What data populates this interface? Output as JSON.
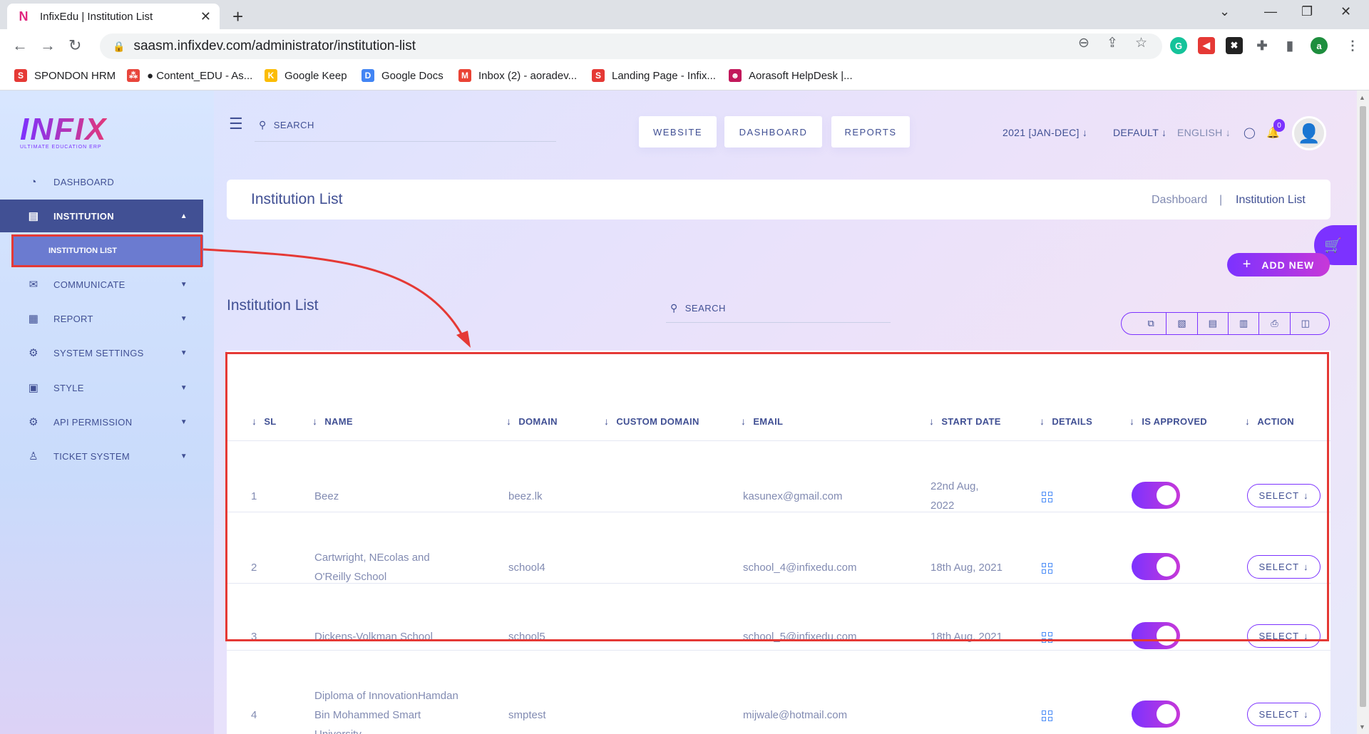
{
  "browser": {
    "tab_title": "InfixEdu | Institution List",
    "url": "saasm.infixdev.com/administrator/institution-list",
    "profile_initial": "a",
    "bookmarks": [
      {
        "label": "SPONDON HRM",
        "color": "#e53935",
        "icon": "S"
      },
      {
        "label": "● Content_EDU - As...",
        "color": "#e8453c",
        "icon": "⁂"
      },
      {
        "label": "Google Keep",
        "color": "#fbbc04",
        "icon": "K"
      },
      {
        "label": "Google Docs",
        "color": "#4285f4",
        "icon": "D"
      },
      {
        "label": "Inbox (2) - aoradev...",
        "color": "#ea4335",
        "icon": "M"
      },
      {
        "label": "Landing Page - Infix...",
        "color": "#e53935",
        "icon": "S"
      },
      {
        "label": "Aorasoft HelpDesk |...",
        "color": "#c2185b",
        "icon": "☻"
      }
    ]
  },
  "logo": {
    "text": "INFIX",
    "subtitle": "ULTIMATE EDUCATION ERP"
  },
  "sidebar": {
    "items": [
      {
        "label": "DASHBOARD",
        "icon": "gauge-icon"
      },
      {
        "label": "INSTITUTION",
        "icon": "institution-icon"
      },
      {
        "label": "COMMUNICATE",
        "icon": "communicate-icon"
      },
      {
        "label": "REPORT",
        "icon": "report-icon"
      },
      {
        "label": "SYSTEM SETTINGS",
        "icon": "settings-icon"
      },
      {
        "label": "STYLE",
        "icon": "style-icon"
      },
      {
        "label": "API PERMISSION",
        "icon": "api-icon"
      },
      {
        "label": "TICKET SYSTEM",
        "icon": "ticket-icon"
      }
    ],
    "sub_item": "INSTITUTION LIST"
  },
  "header": {
    "search_placeholder": "SEARCH",
    "buttons": [
      "WEBSITE",
      "DASHBOARD",
      "REPORTS"
    ],
    "session": "2021 [JAN-DEC]",
    "theme": "DEFAULT",
    "language": "ENGLISH",
    "notification_count": "0"
  },
  "page": {
    "title": "Institution List",
    "breadcrumb": [
      "Dashboard",
      "|",
      "Institution List"
    ],
    "add_new": "ADD NEW",
    "section_title": "Institution List",
    "table_search": "SEARCH"
  },
  "table": {
    "columns": [
      "SL",
      "NAME",
      "DOMAIN",
      "CUSTOM DOMAIN",
      "EMAIL",
      "START DATE",
      "DETAILS",
      "IS APPROVED",
      "ACTION"
    ],
    "rows": [
      {
        "sl": "1",
        "name": [
          "Beez"
        ],
        "domain": "beez.lk",
        "custom_domain": "",
        "email": "kasunex@gmail.com",
        "start_date": [
          "22nd Aug,",
          "2022"
        ],
        "approved": true,
        "action": "SELECT"
      },
      {
        "sl": "2",
        "name": [
          "Cartwright, NEcolas and",
          "O'Reilly School"
        ],
        "domain": "school4",
        "custom_domain": "",
        "email": "school_4@infixedu.com",
        "start_date": [
          "18th Aug, 2021"
        ],
        "approved": true,
        "action": "SELECT"
      },
      {
        "sl": "3",
        "name": [
          "Dickens-Volkman School"
        ],
        "domain": "school5",
        "custom_domain": "",
        "email": "school_5@infixedu.com",
        "start_date": [
          "18th Aug, 2021"
        ],
        "approved": true,
        "action": "SELECT"
      },
      {
        "sl": "4",
        "name": [
          "Diploma of InnovationHamdan",
          "Bin Mohammed Smart",
          "University"
        ],
        "domain": "smptest",
        "custom_domain": "",
        "email": "mijwale@hotmail.com",
        "start_date": [
          ""
        ],
        "approved": true,
        "action": "SELECT"
      }
    ]
  },
  "colors": {
    "primary": "#415094",
    "accent": "#7c32ff",
    "highlight": "#e53935"
  }
}
